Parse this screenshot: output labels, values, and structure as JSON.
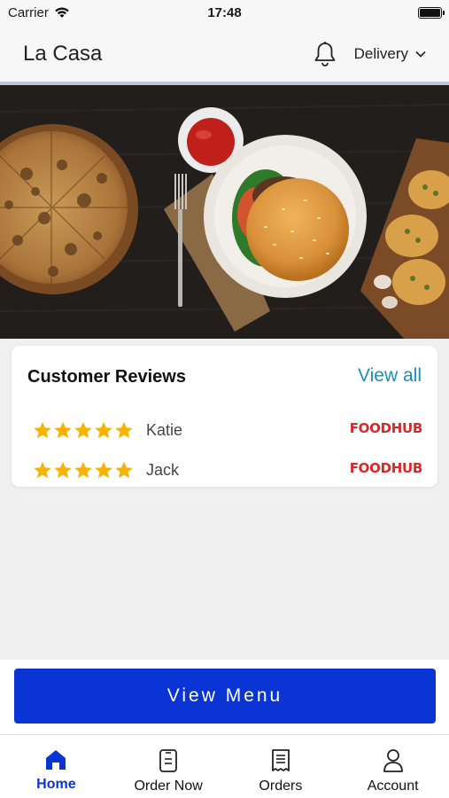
{
  "status_bar": {
    "carrier": "Carrier",
    "time": "17:48"
  },
  "header": {
    "brand": "La Casa",
    "delivery_label": "Delivery"
  },
  "reviews": {
    "title": "Customer Reviews",
    "view_all": "View all",
    "items": [
      {
        "name": "Katie",
        "rating": 5,
        "source": "FOODHUB"
      },
      {
        "name": "Jack",
        "rating": 5,
        "source": "FOODHUB"
      }
    ]
  },
  "cta": {
    "view_menu": "View Menu"
  },
  "tabs": [
    {
      "label": "Home",
      "icon": "home-icon",
      "active": true
    },
    {
      "label": "Order Now",
      "icon": "order-now-icon",
      "active": false
    },
    {
      "label": "Orders",
      "icon": "receipt-icon",
      "active": false
    },
    {
      "label": "Account",
      "icon": "account-icon",
      "active": false
    }
  ],
  "colors": {
    "primary": "#0a34d4",
    "link": "#1a8fb8",
    "star": "#f6b300",
    "foodhub_red": "#d62a2a"
  }
}
